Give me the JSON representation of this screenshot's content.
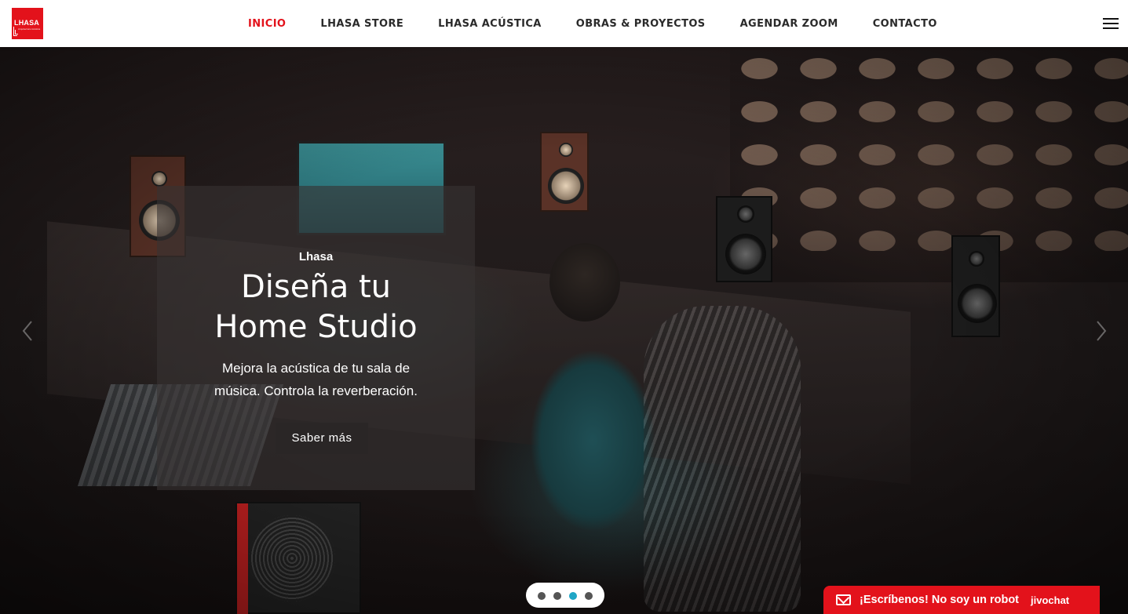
{
  "header": {
    "logo_text": "LHASA",
    "logo_sub": "Arquitectura Acústica",
    "nav": [
      {
        "label": "INICIO",
        "active": true
      },
      {
        "label": "LHASA STORE",
        "active": false
      },
      {
        "label": "LHASA ACÚSTICA",
        "active": false
      },
      {
        "label": "OBRAS & PROYECTOS",
        "active": false
      },
      {
        "label": "AGENDAR ZOOM",
        "active": false
      },
      {
        "label": "CONTACTO",
        "active": false
      }
    ]
  },
  "hero": {
    "kicker": "Lhasa",
    "title_line1": "Diseña tu",
    "title_line2": "Home Studio",
    "body_line1": "Mejora la acústica de tu sala de",
    "body_line2": "música. Controla la reverberación.",
    "cta_label": "Saber más",
    "slides_count": 4,
    "active_slide": 3
  },
  "chat": {
    "label": "¡Escríbenos! No soy un robot",
    "brand": "jivochat"
  },
  "colors": {
    "brand_red": "#e3121b",
    "dot_active": "#1fa6c6"
  }
}
